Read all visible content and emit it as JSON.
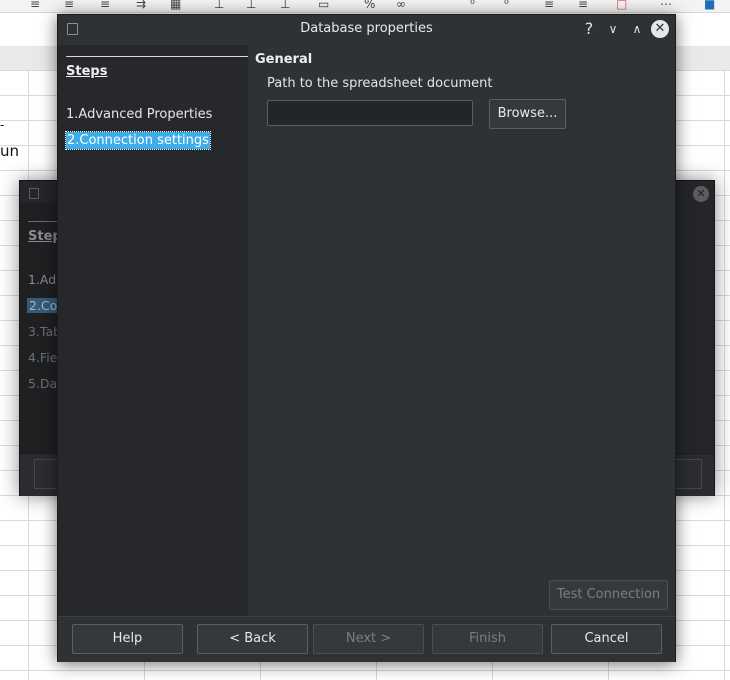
{
  "dialog": {
    "title": "Database properties",
    "steps_title": "Steps",
    "steps": [
      {
        "label": "1.Advanced Properties"
      },
      {
        "label": "2.Connection settings"
      }
    ],
    "section_title": "General",
    "path_label": "Path to the spreadsheet document",
    "path_value": "",
    "browse_label": "Browse...",
    "test_connection_label": "Test Connection",
    "buttons": {
      "help": "Help",
      "back": "< Back",
      "next": "Next >",
      "finish": "Finish",
      "cancel": "Cancel"
    }
  },
  "background_dialog": {
    "steps_title": "Step",
    "steps": [
      "1.Ad",
      "2.Co",
      "3.Tab",
      "4.Fie",
      "5.Da"
    ]
  },
  "spreadsheet": {
    "cell_text": "un"
  }
}
